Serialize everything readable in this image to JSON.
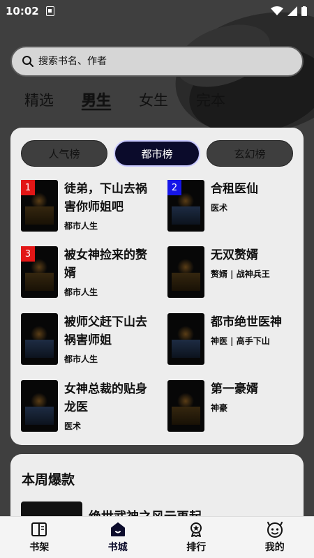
{
  "status_bar": {
    "time": "10:02"
  },
  "search": {
    "placeholder": "搜索书名、作者"
  },
  "category_tabs": [
    {
      "label": "精选"
    },
    {
      "label": "男生"
    },
    {
      "label": "女生"
    },
    {
      "label": "完本"
    }
  ],
  "active_category": "男生",
  "rank_tabs": [
    {
      "label": "人气榜"
    },
    {
      "label": "都市榜"
    },
    {
      "label": "玄幻榜"
    }
  ],
  "active_rank": "都市榜",
  "books": [
    {
      "rank": "1",
      "title": "徒弟，下山去祸害你师姐吧",
      "tags": "都市人生"
    },
    {
      "rank": "2",
      "title": "合租医仙",
      "tags": "医术"
    },
    {
      "rank": "3",
      "title": "被女神捡来的赘婿",
      "tags": "都市人生"
    },
    {
      "rank": "",
      "title": "无双赘婿",
      "tags": "赘婿 | 战神兵王"
    },
    {
      "rank": "",
      "title": "被师父赶下山去祸害师姐",
      "tags": "都市人生"
    },
    {
      "rank": "",
      "title": "都市绝世医神",
      "tags": "神医 | 高手下山"
    },
    {
      "rank": "",
      "title": "女神总裁的贴身龙医",
      "tags": "医术"
    },
    {
      "rank": "",
      "title": "第一豪婿",
      "tags": "神豪"
    }
  ],
  "weekly": {
    "title": "本周爆款",
    "book_title": "绝世武神之风云再起"
  },
  "bottom_nav": [
    {
      "label": "书架",
      "icon": "book-icon"
    },
    {
      "label": "书城",
      "icon": "home-icon"
    },
    {
      "label": "排行",
      "icon": "medal-icon"
    },
    {
      "label": "我的",
      "icon": "profile-icon"
    }
  ],
  "colors": {
    "background": "#3f3f3f",
    "card": "#ededed",
    "rank_red": "#e21616",
    "rank_blue": "#1616e8",
    "active_tab": "#0b0b2b"
  }
}
